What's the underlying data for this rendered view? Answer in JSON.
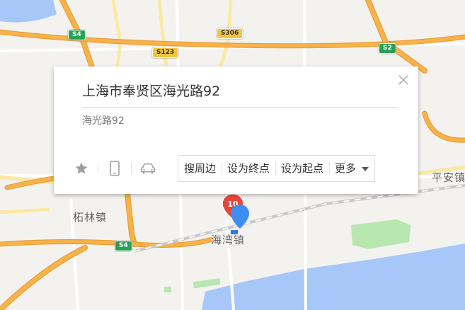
{
  "map": {
    "colors": {
      "land": "#f3f2ef",
      "water": "#a7c7f8",
      "expressway": "#f7b24a",
      "expressway_edge": "#e59a2f",
      "road_yellow": "#fbe9a3",
      "park": "#b7e6ae",
      "railway": "#c8c8c8"
    },
    "road_shields": [
      {
        "label": "S4",
        "style": "green"
      },
      {
        "label": "S306",
        "style": "yellow"
      },
      {
        "label": "S123",
        "style": "yellow"
      },
      {
        "label": "S2",
        "style": "green"
      },
      {
        "label": "S4",
        "style": "green"
      }
    ],
    "places": [
      {
        "label": "柘林镇"
      },
      {
        "label": "海湾镇"
      },
      {
        "label": "平安镇"
      }
    ]
  },
  "popup": {
    "title": "上海市奉贤区海光路92",
    "subtitle": "海光路92",
    "close_icon": "close-icon",
    "tools": [
      {
        "name": "favorite",
        "icon": "star-icon"
      },
      {
        "name": "send-to-phone",
        "icon": "phone-icon"
      },
      {
        "name": "drive",
        "icon": "car-icon"
      }
    ],
    "actions": {
      "search_nearby": "搜周边",
      "set_destination": "设为终点",
      "set_origin": "设为起点",
      "more": "更多"
    }
  },
  "markers": {
    "poi_badge": "10",
    "location_pin": "map-pin-icon",
    "badge_color": "#e8463b",
    "pin_color": "#3d8ef0"
  }
}
